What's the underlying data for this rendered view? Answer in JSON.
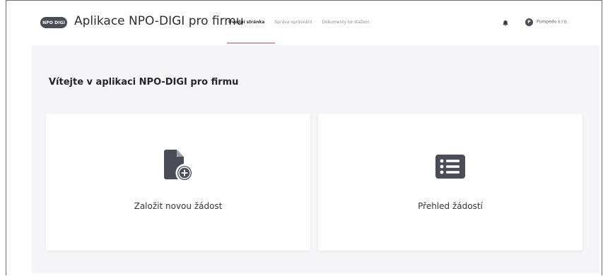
{
  "header": {
    "logo_text": "NPO DIGI",
    "app_title": "Aplikace NPO-DIGI pro firmu",
    "nav": [
      {
        "label": "Úvodní stránka",
        "active": true
      },
      {
        "label": "Správa oprávnění",
        "active": false
      },
      {
        "label": "Dokumenty ke stažení",
        "active": false
      }
    ],
    "user": {
      "avatar_initial": "P",
      "name": "Pumpedu s.r.o."
    }
  },
  "main": {
    "title": "Vítejte v aplikaci NPO-DIGI pro firmu",
    "cards": [
      {
        "label": "Založit novou žádost",
        "icon": "file-plus-icon"
      },
      {
        "label": "Přehled žádostí",
        "icon": "list-icon"
      }
    ]
  },
  "colors": {
    "accent_underline": "#c9a0b4",
    "icon_dark": "#4a4d57",
    "content_bg": "#f5f5f7"
  }
}
